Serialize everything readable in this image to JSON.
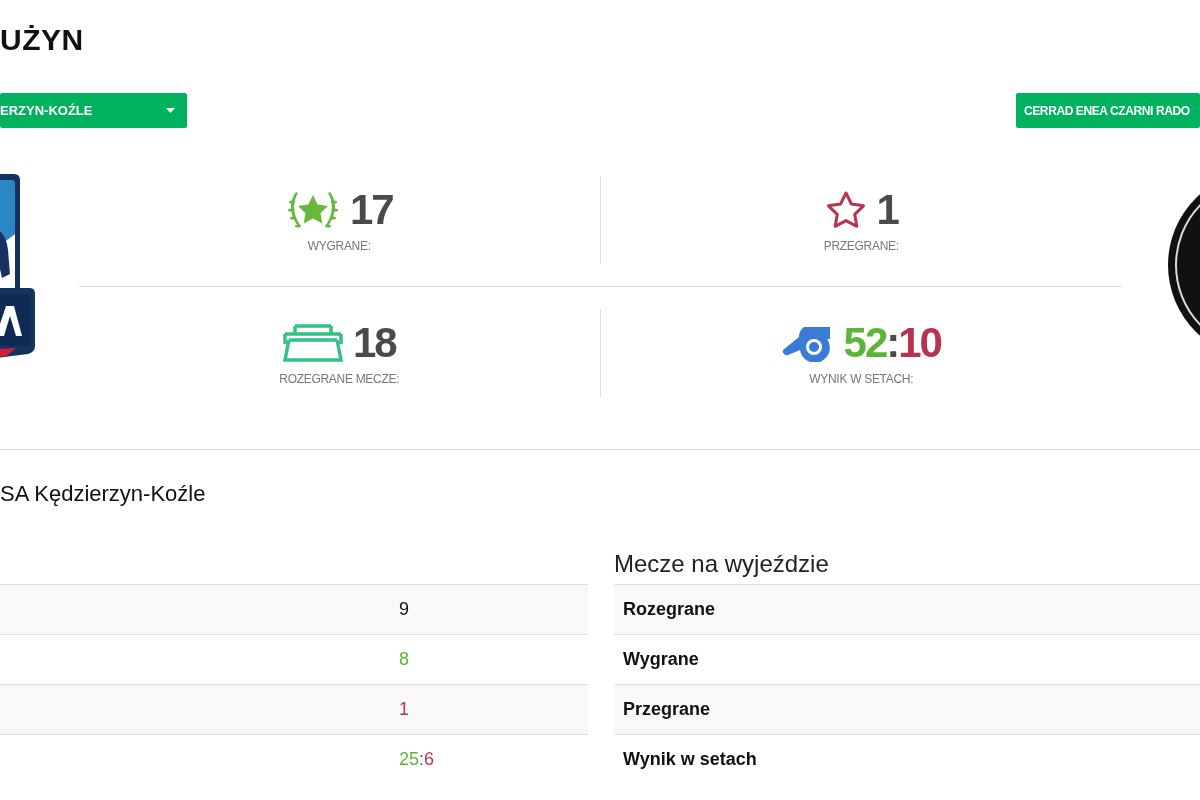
{
  "page_title": "UŻYN",
  "team_buttons": [
    {
      "kind": "dropdown",
      "label": "ERZYN-KOŹLE"
    },
    {
      "kind": "button",
      "label": "CERRAD ENEA CZARNI RADO"
    }
  ],
  "stats": [
    {
      "kind": "wins",
      "value": "17",
      "label": "WYGRANE:"
    },
    {
      "kind": "losses",
      "value": "1",
      "label": "PRZEGRANE:"
    },
    {
      "kind": "played",
      "value": "18",
      "label": "ROZEGRANE MECZE:"
    },
    {
      "kind": "sets",
      "won": "52",
      "separator": ":",
      "lost": "10",
      "label": "WYNIK W SETACH:"
    }
  ],
  "team_name": "SA Kędzierzyn-Koźle",
  "home_table": {
    "rows": [
      {
        "kind": "neutral",
        "value": "9"
      },
      {
        "kind": "win",
        "value": "8"
      },
      {
        "kind": "loss",
        "value": "1"
      },
      {
        "kind": "sets",
        "won": "25",
        "separator": ":",
        "lost": "6"
      }
    ]
  },
  "away_table": {
    "title": "Mecze na wyjeździe",
    "rows": [
      {
        "label": "Rozegrane"
      },
      {
        "label": "Wygrane"
      },
      {
        "label": "Przegrane"
      },
      {
        "label": "Wynik w setach"
      }
    ]
  }
}
